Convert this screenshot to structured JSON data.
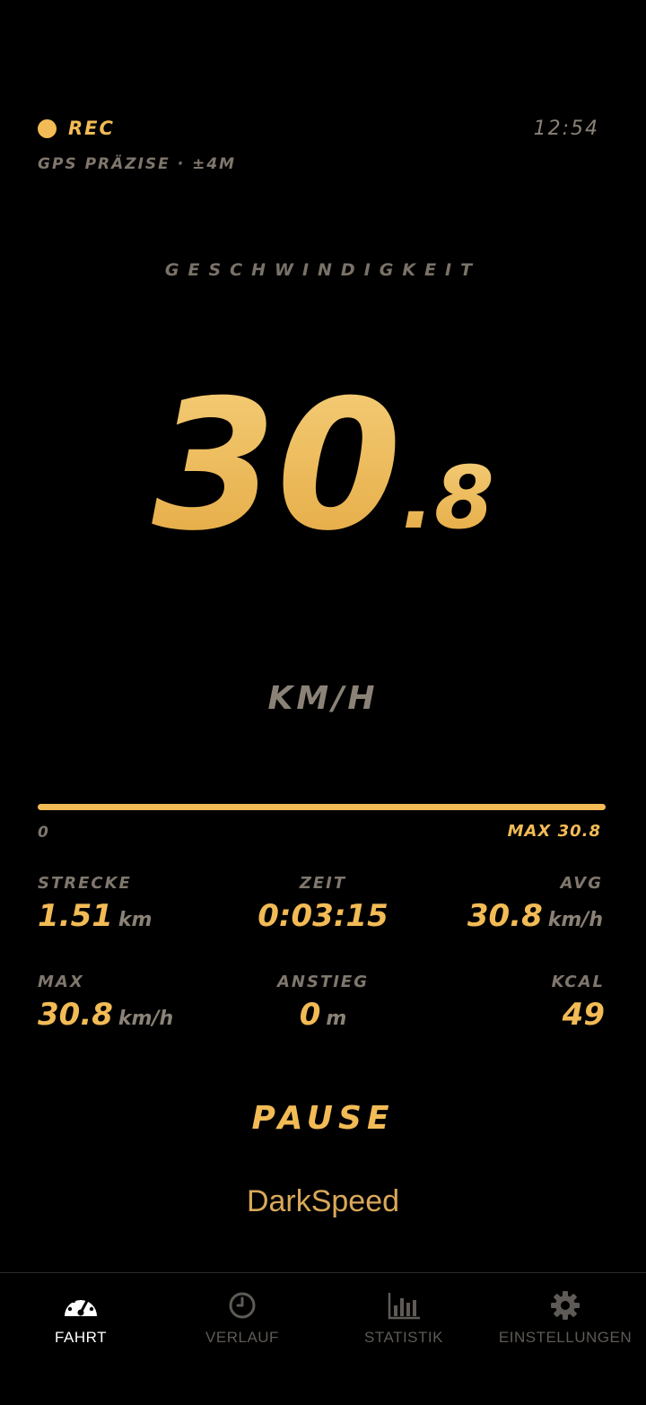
{
  "status": {
    "rec_label": "REC",
    "clock": "12:54",
    "gps": "GPS PRÄZISE · ±4M"
  },
  "speed": {
    "title": "GESCHWINDIGKEIT",
    "integer": "30",
    "decimal": ".8",
    "unit": "KM/H"
  },
  "progress": {
    "min_label": "0",
    "max_label": "MAX 30.8",
    "fraction": 1.0
  },
  "stats": [
    {
      "label": "STRECKE",
      "value": "1.51",
      "unit": "km"
    },
    {
      "label": "ZEIT",
      "value": "0:03:15",
      "unit": ""
    },
    {
      "label": "AVG",
      "value": "30.8",
      "unit": "km/h"
    },
    {
      "label": "MAX",
      "value": "30.8",
      "unit": "km/h"
    },
    {
      "label": "ANSTIEG",
      "value": "0",
      "unit": "m"
    },
    {
      "label": "KCAL",
      "value": "49",
      "unit": ""
    }
  ],
  "pause_label": "PAUSE",
  "brand": "DarkSpeed",
  "tabs": [
    {
      "label": "FAHRT",
      "icon": "speedometer-icon",
      "active": true
    },
    {
      "label": "VERLAUF",
      "icon": "clock-icon",
      "active": false
    },
    {
      "label": "STATISTIK",
      "icon": "bar-chart-icon",
      "active": false
    },
    {
      "label": "EINSTELLUNGEN",
      "icon": "gear-icon",
      "active": false
    }
  ],
  "colors": {
    "accent": "#f2bb55",
    "muted": "#7f776d",
    "background": "#000000"
  }
}
